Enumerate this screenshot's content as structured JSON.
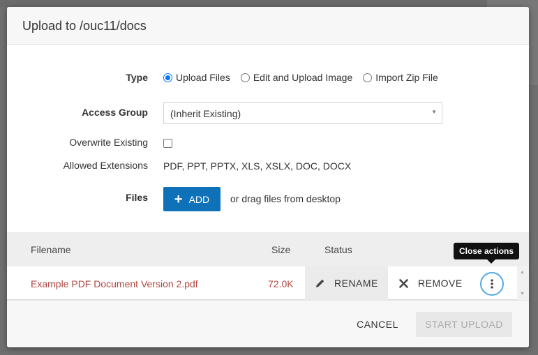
{
  "dialog": {
    "title": "Upload to /ouc11/docs"
  },
  "form": {
    "type_label": "Type",
    "type_options": [
      {
        "label": "Upload Files",
        "selected": true
      },
      {
        "label": "Edit and Upload Image",
        "selected": false
      },
      {
        "label": "Import Zip File",
        "selected": false
      }
    ],
    "access_group_label": "Access Group",
    "access_group_value": "(Inherit Existing)",
    "overwrite_label": "Overwrite Existing",
    "overwrite_checked": false,
    "allowed_extensions_label": "Allowed Extensions",
    "allowed_extensions_value": "PDF,  PPT,  PPTX,  XLS,  XSLX,  DOC,  DOCX",
    "files_label": "Files",
    "add_button_label": "ADD",
    "add_button_icon": "plus-icon",
    "drag_hint": "or drag files from desktop"
  },
  "table": {
    "headers": {
      "filename": "Filename",
      "size": "Size",
      "status": "Status"
    },
    "rows": [
      {
        "filename": "Example PDF Document Version 2.pdf",
        "size": "72.0K",
        "rename_label": "RENAME",
        "remove_label": "REMOVE"
      }
    ]
  },
  "tooltip": {
    "text": "Close actions"
  },
  "footer": {
    "cancel_label": "CANCEL",
    "start_upload_label": "START UPLOAD",
    "start_upload_disabled": true
  },
  "colors": {
    "accent": "#0f72b9",
    "radio_checked": "#0075ff",
    "filename_text": "#b2463f",
    "actions_ring": "#55a9e4"
  }
}
